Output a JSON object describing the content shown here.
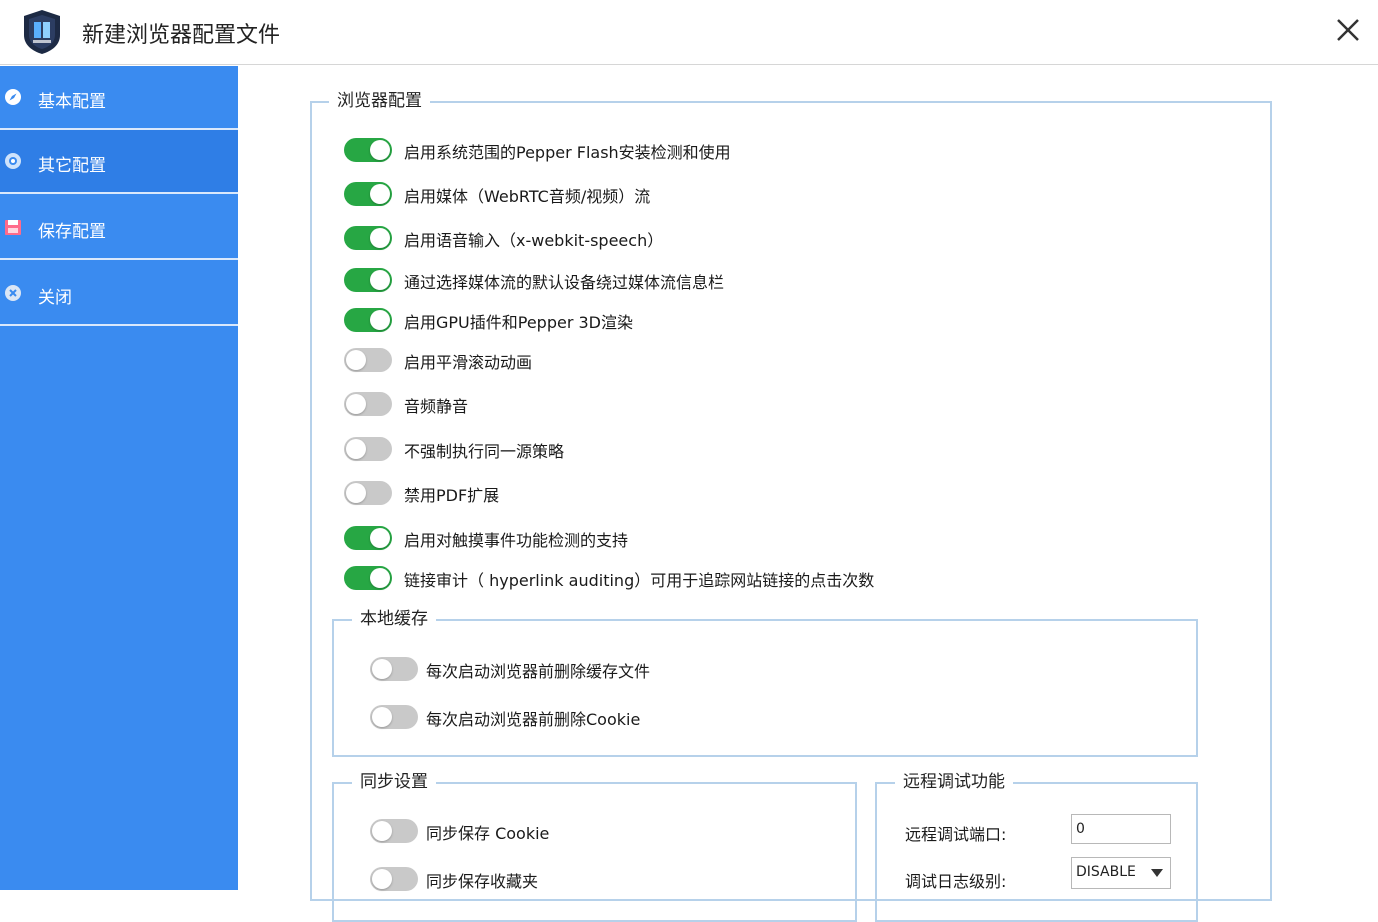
{
  "window": {
    "title": "新建浏览器配置文件"
  },
  "sidebar": {
    "items": [
      {
        "label": "基本配置"
      },
      {
        "label": "其它配置"
      },
      {
        "label": "保存配置"
      },
      {
        "label": "关闭"
      }
    ]
  },
  "browser_config": {
    "title": "浏览器配置",
    "options": [
      {
        "label": "启用系统范围的Pepper Flash安装检测和使用",
        "enabled": true
      },
      {
        "label": "启用媒体（WebRTC音频/视频）流",
        "enabled": true
      },
      {
        "label": "启用语音输入（x-webkit-speech）",
        "enabled": true
      },
      {
        "label": "通过选择媒体流的默认设备绕过媒体流信息栏",
        "enabled": true
      },
      {
        "label": "启用GPU插件和Pepper 3D渲染",
        "enabled": true
      },
      {
        "label": "启用平滑滚动动画",
        "enabled": false
      },
      {
        "label": "音频静音",
        "enabled": false
      },
      {
        "label": "不强制执行同一源策略",
        "enabled": false
      },
      {
        "label": "禁用PDF扩展",
        "enabled": false
      },
      {
        "label": "启用对触摸事件功能检测的支持",
        "enabled": true
      },
      {
        "label": "链接审计（ hyperlink auditing）可用于追踪网站链接的点击次数",
        "enabled": true
      }
    ]
  },
  "local_cache": {
    "title": "本地缓存",
    "options": [
      {
        "label": "每次启动浏览器前删除缓存文件",
        "enabled": false
      },
      {
        "label": "每次启动浏览器前删除Cookie",
        "enabled": false
      }
    ]
  },
  "sync": {
    "title": "同步设置",
    "options": [
      {
        "label": "同步保存 Cookie",
        "enabled": false
      },
      {
        "label": "同步保存收藏夹",
        "enabled": false
      }
    ]
  },
  "remote_debug": {
    "title": "远程调试功能",
    "port_label": "远程调试端口:",
    "port_value": "0",
    "log_level_label": "调试日志级别:",
    "log_level_value": "DISABLE"
  },
  "colors": {
    "sidebar_bg": "#3a8bf0",
    "toggle_on": "#27a744",
    "toggle_off": "#c9c9c9",
    "group_border": "#b6d1ea"
  }
}
